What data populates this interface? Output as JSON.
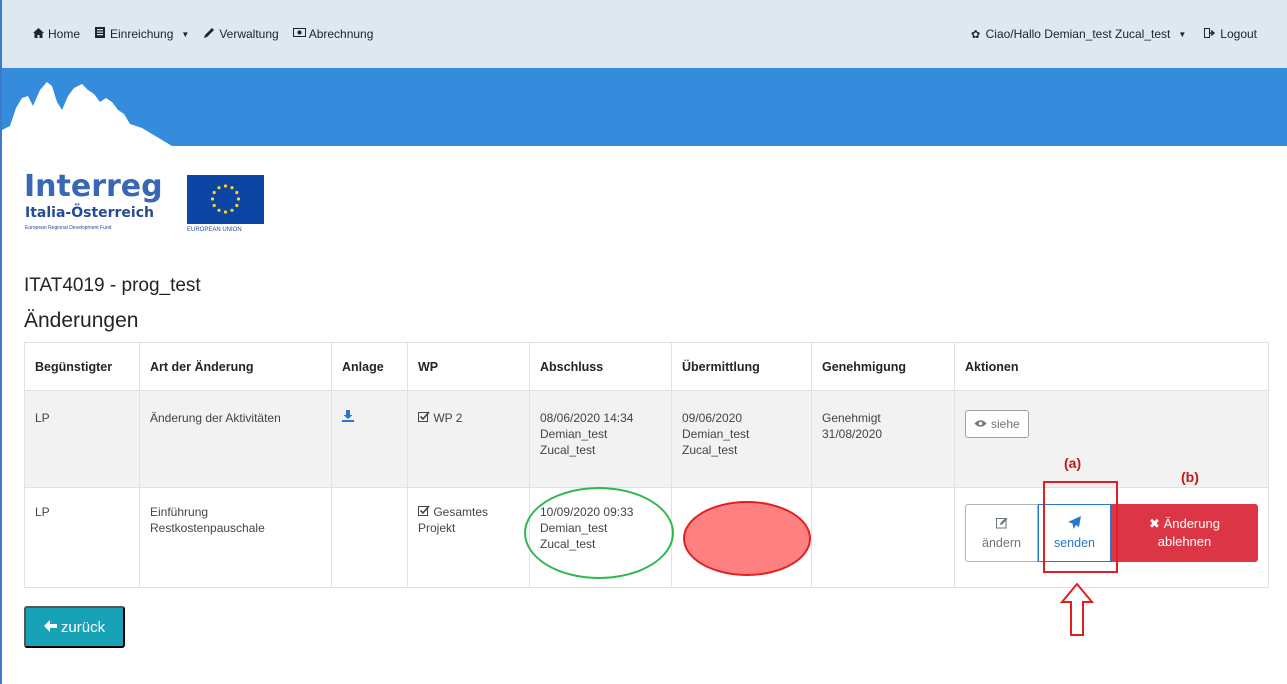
{
  "navbar": {
    "home": "Home",
    "einreichung": "Einreichung",
    "verwaltung": "Verwaltung",
    "abrechnung": "Abrechnung",
    "user": "Ciao/Hallo Demian_test Zucal_test",
    "logout": "Logout"
  },
  "logo": {
    "word": "Interreg",
    "sub": "Italia-Österreich",
    "fund": "European Regional Development Fund",
    "eu": "EUROPEAN UNION"
  },
  "page": {
    "title": "ITAT4019 - prog_test",
    "section": "Änderungen"
  },
  "table": {
    "headers": [
      "Begünstigter",
      "Art der Änderung",
      "Anlage",
      "WP",
      "Abschluss",
      "Übermittlung",
      "Genehmigung",
      "Aktionen"
    ],
    "rows": [
      {
        "beneficiary": "LP",
        "type": "Änderung der Aktivitäten",
        "wp": "WP 2",
        "abschluss": [
          "08/06/2020 14:34",
          "Demian_test",
          "Zucal_test"
        ],
        "uebermittlung": [
          "09/06/2020",
          "Demian_test",
          "Zucal_test"
        ],
        "genehmigung": [
          "Genehmigt",
          "31/08/2020"
        ],
        "action": "siehe"
      },
      {
        "beneficiary": "LP",
        "type": [
          "Einführung",
          "Restkostenpauschale"
        ],
        "wp": [
          "Gesamtes",
          "Projekt"
        ],
        "abschluss": [
          "10/09/2020 09:33",
          "Demian_test",
          "Zucal_test"
        ],
        "action_edit": "ändern",
        "action_send": "senden",
        "action_reject": [
          "Änderung",
          "ablehnen"
        ]
      }
    ]
  },
  "back_button": "zurück",
  "annotations": {
    "a": "(a)",
    "b": "(b)"
  },
  "colors": {
    "navbar_bg": "#dde8f1",
    "banner_bg": "#358cdc",
    "primary_blue": "#2a77c9",
    "danger_red": "#dc3545",
    "info_teal": "#17a2b8",
    "annotation_green": "#2eb84d",
    "annotation_red": "#e02020"
  }
}
